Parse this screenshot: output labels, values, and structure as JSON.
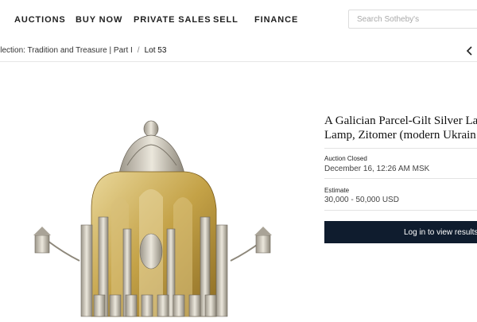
{
  "nav": {
    "items": [
      "AUCTIONS",
      "BUY NOW",
      "PRIVATE SALES",
      "SELL",
      "FINANCE"
    ],
    "search_placeholder": "Search Sotheby's"
  },
  "breadcrumb": {
    "collection": "llection: Tradition and Treasure | Part I",
    "separator": "/",
    "current": "Lot 53"
  },
  "lot": {
    "title_line1": "A Galician Parcel-Gilt Silver Lar",
    "title_line2": "Lamp, Zitomer (modern Ukrain",
    "status_label": "Auction Closed",
    "status_value": "December 16, 12:26 AM MSK",
    "estimate_label": "Estimate",
    "estimate_value": "30,000 - 50,000 USD",
    "cta_label": "Log in to view results"
  },
  "colors": {
    "cta_bg": "#0f1c2e",
    "gilt": "#c9a94a",
    "silver": "#d8d3c6"
  },
  "icons": {
    "back": "chevron-left-icon"
  }
}
